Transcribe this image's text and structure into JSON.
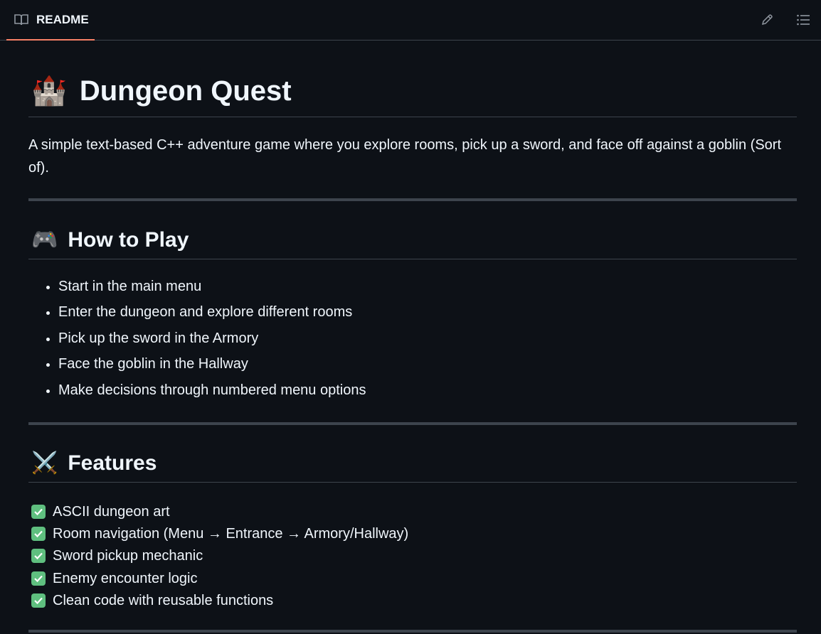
{
  "tab": {
    "label": "README",
    "icon": "book-icon"
  },
  "toolbar": {
    "edit_icon": "pencil-icon",
    "toc_icon": "list-icon"
  },
  "title": {
    "emoji": "🏰",
    "text": "Dungeon Quest"
  },
  "intro": "A simple text-based C++ adventure game where you explore rooms, pick up a sword, and face off against a goblin (Sort of).",
  "how_to_play": {
    "emoji": "🎮",
    "heading": "How to Play",
    "items": [
      "Start in the main menu",
      "Enter the dungeon and explore different rooms",
      "Pick up the sword in the Armory",
      "Face the goblin in the Hallway",
      "Make decisions through numbered menu options"
    ]
  },
  "features": {
    "emoji": "⚔️",
    "heading": "Features",
    "items": [
      "ASCII dungeon art",
      "Room navigation (Menu → Entrance → Armory/Hallway)",
      "Sword pickup mechanic",
      "Enemy encounter logic",
      "Clean code with reusable functions"
    ]
  },
  "colors": {
    "background": "#0d1117",
    "accent": "#f78166",
    "border": "#3d444d",
    "check": "#5fbf7f"
  }
}
